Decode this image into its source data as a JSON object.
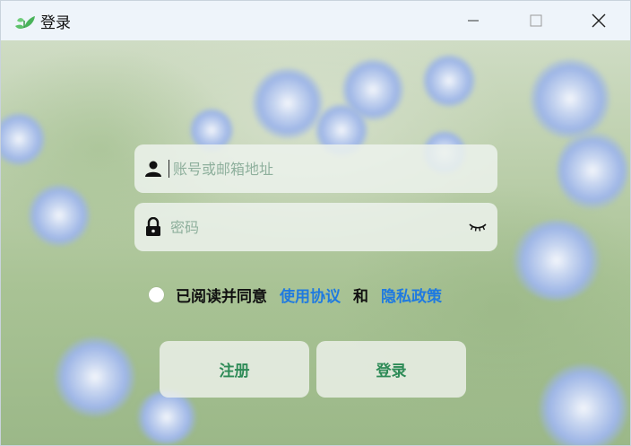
{
  "window": {
    "title": "登录"
  },
  "form": {
    "account_placeholder": "账号或邮箱地址",
    "password_placeholder": "密码"
  },
  "agreement": {
    "prefix": "已阅读并同意",
    "terms_link": "使用协议",
    "and": "和",
    "privacy_link": "隐私政策"
  },
  "buttons": {
    "register": "注册",
    "login": "登录"
  },
  "colors": {
    "accent_green": "#2e8b57",
    "link_blue": "#1f7ae0"
  },
  "icons": [
    "leaf-logo-icon",
    "minimize-icon",
    "maximize-icon",
    "close-icon",
    "user-icon",
    "lock-icon",
    "eye-closed-icon"
  ]
}
